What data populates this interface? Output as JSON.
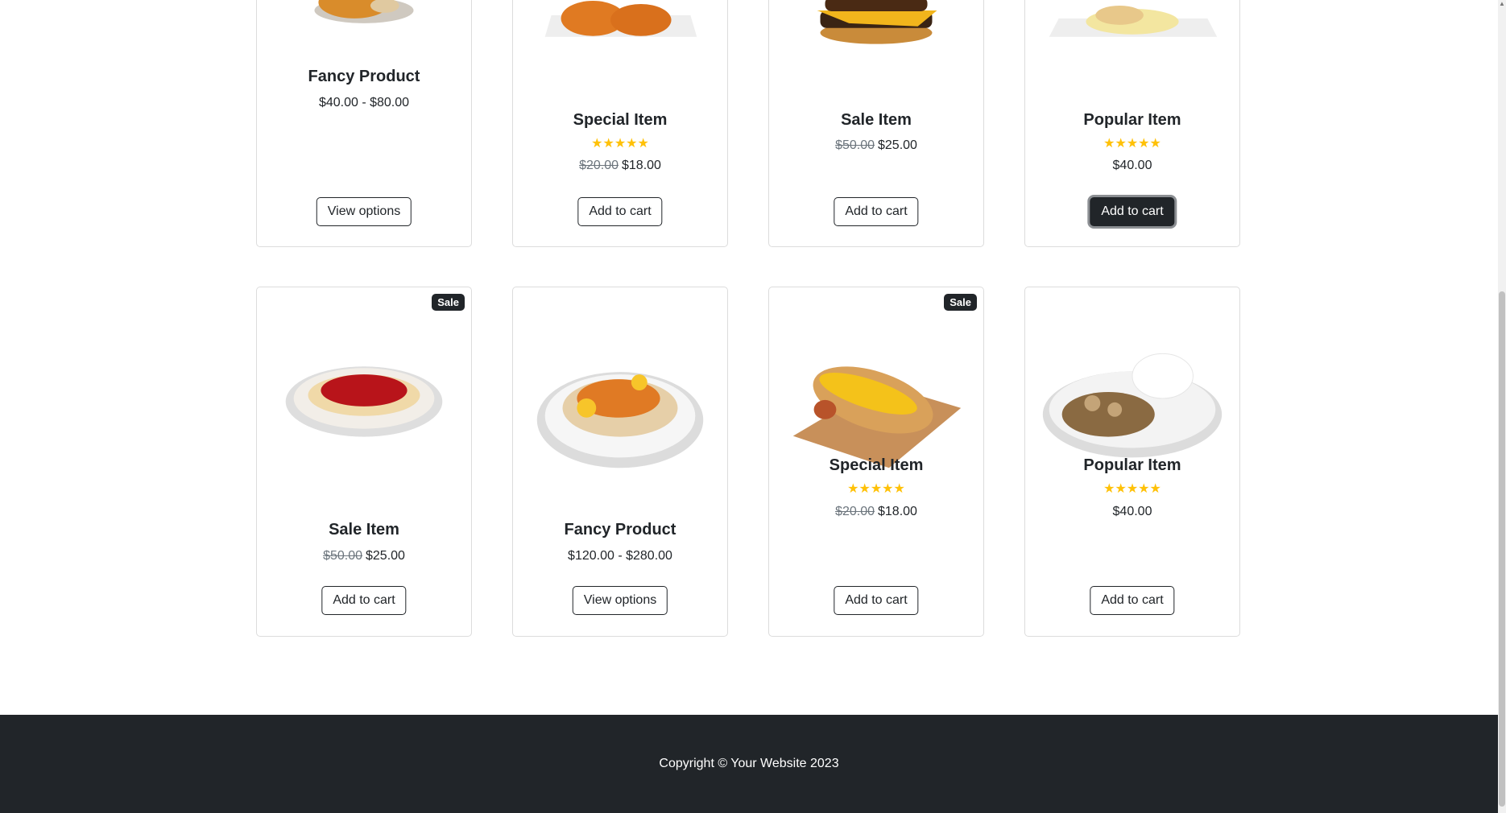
{
  "row1": [
    {
      "title": "Fancy Product",
      "price": "$40.00 - $80.00",
      "button": "View options"
    },
    {
      "title": "Special Item",
      "rating": "★★★★★",
      "old_price": "$20.00",
      "price": "$18.00",
      "button": "Add to cart"
    },
    {
      "title": "Sale Item",
      "old_price": "$50.00",
      "price": "$25.00",
      "button": "Add to cart"
    },
    {
      "title": "Popular Item",
      "rating": "★★★★★",
      "price": "$40.00",
      "button": "Add to cart"
    }
  ],
  "row2": [
    {
      "badge": "Sale",
      "title": "Sale Item",
      "old_price": "$50.00",
      "price": "$25.00",
      "button": "Add to cart"
    },
    {
      "title": "Fancy Product",
      "price": "$120.00 - $280.00",
      "button": "View options"
    },
    {
      "badge": "Sale",
      "title": "Special Item",
      "rating": "★★★★★",
      "old_price": "$20.00",
      "price": "$18.00",
      "button": "Add to cart"
    },
    {
      "title": "Popular Item",
      "rating": "★★★★★",
      "price": "$40.00",
      "button": "Add to cart"
    }
  ],
  "footer": {
    "copyright": "Copyright © Your Website 2023"
  },
  "colors": {
    "dark": "#212529",
    "star": "#ffc107",
    "muted": "#6c757d"
  }
}
